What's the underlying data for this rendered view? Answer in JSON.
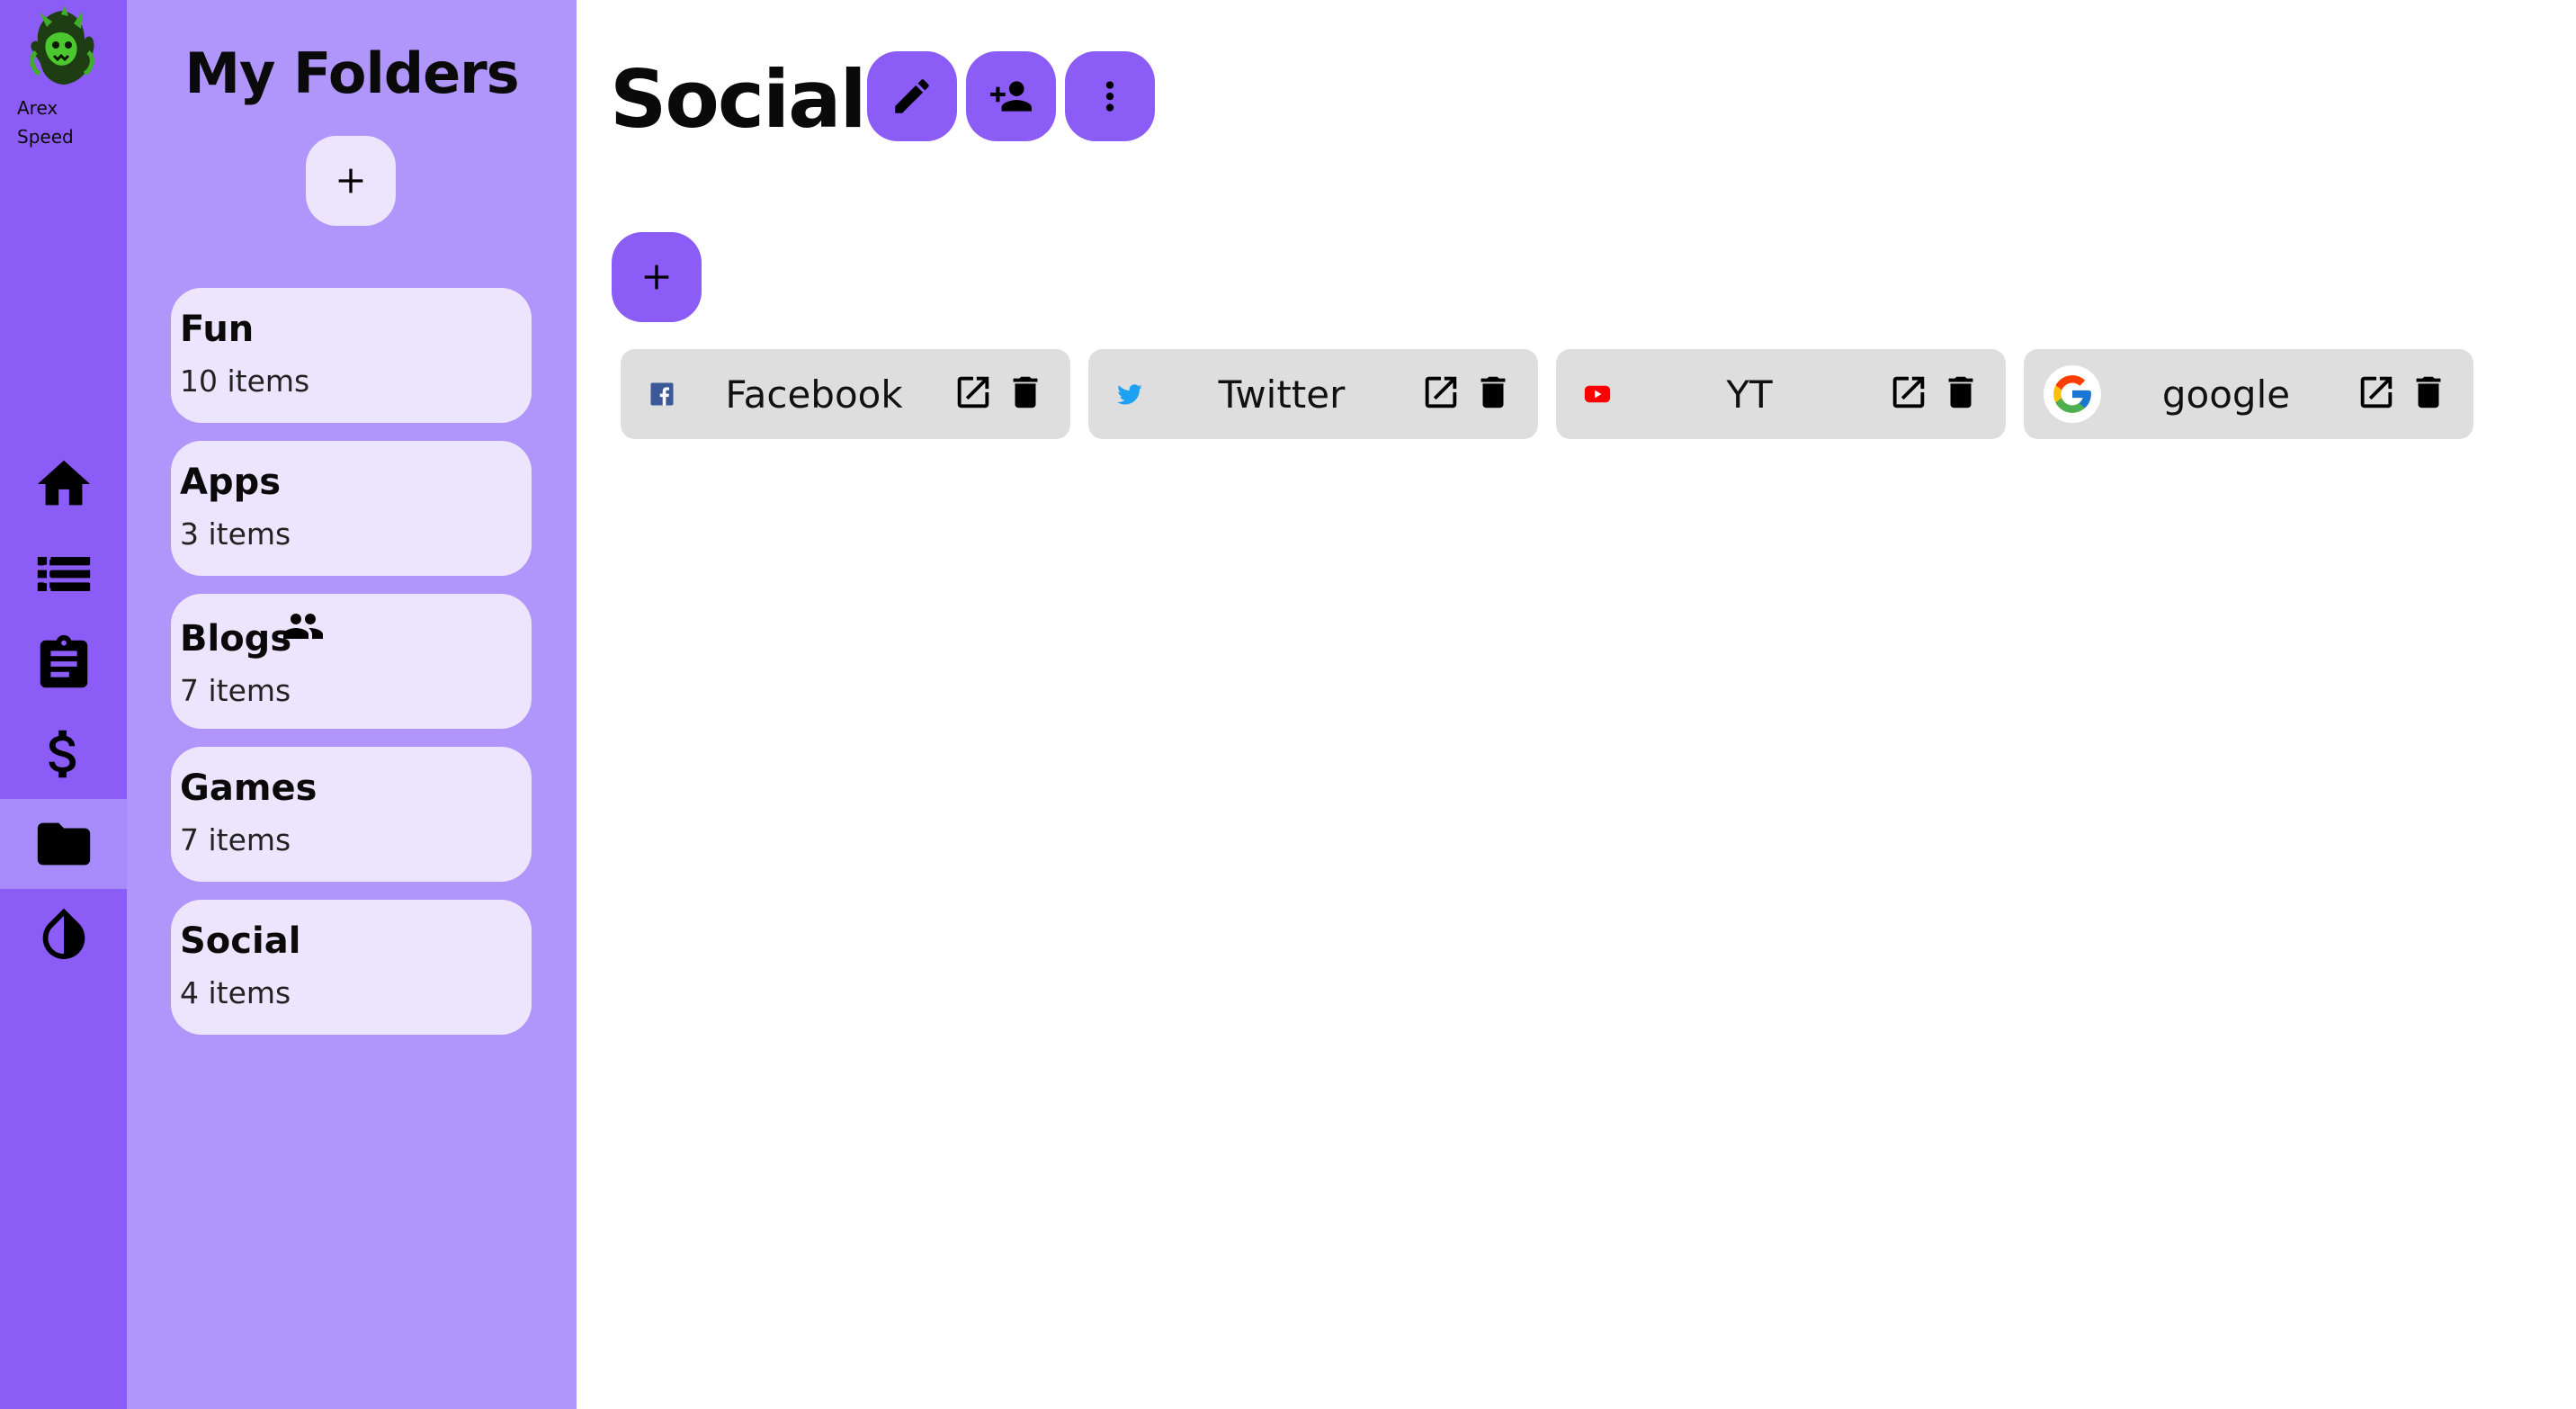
{
  "user": {
    "name_line1": "Arex",
    "name_line2": "Speed",
    "avatar_icon": "green-dragon-avatar"
  },
  "nav": {
    "items": [
      {
        "id": "home",
        "icon": "home-icon",
        "active": false
      },
      {
        "id": "list",
        "icon": "list-icon",
        "active": false
      },
      {
        "id": "clipboard",
        "icon": "clipboard-icon",
        "active": false
      },
      {
        "id": "money",
        "icon": "dollar-icon",
        "active": false
      },
      {
        "id": "folders",
        "icon": "folder-icon",
        "active": true
      },
      {
        "id": "theme",
        "icon": "contrast-drop-icon",
        "active": false
      }
    ]
  },
  "folders_panel": {
    "title": "My Folders",
    "add_icon": "plus-icon",
    "folders": [
      {
        "name": "Fun",
        "count": "10 items",
        "shared": false
      },
      {
        "name": "Apps",
        "count": "3 items",
        "shared": false
      },
      {
        "name": "Blogs",
        "count": "7 items",
        "shared": true,
        "shared_icon": "people-icon"
      },
      {
        "name": "Games",
        "count": "7 items",
        "shared": false
      },
      {
        "name": "Social",
        "count": "4 items",
        "shared": false
      }
    ]
  },
  "main": {
    "title": "Social",
    "actions": [
      {
        "id": "edit",
        "icon": "pencil-icon"
      },
      {
        "id": "share",
        "icon": "add-person-icon"
      },
      {
        "id": "more",
        "icon": "more-vertical-icon"
      }
    ],
    "add_icon": "plus-icon",
    "links": [
      {
        "label": "Facebook",
        "icon": "facebook-icon"
      },
      {
        "label": "Twitter",
        "icon": "twitter-icon"
      },
      {
        "label": "YT",
        "icon": "youtube-icon"
      },
      {
        "label": "google",
        "icon": "google-icon"
      }
    ],
    "link_open_icon": "open-external-icon",
    "link_delete_icon": "trash-icon"
  },
  "colors": {
    "accent": "#8b5cf6",
    "panel": "#b096fb",
    "card": "#ece5fd",
    "link_card": "#dedede",
    "facebook": "#3b5998",
    "twitter": "#1da1f2",
    "youtube": "#ff0000"
  }
}
